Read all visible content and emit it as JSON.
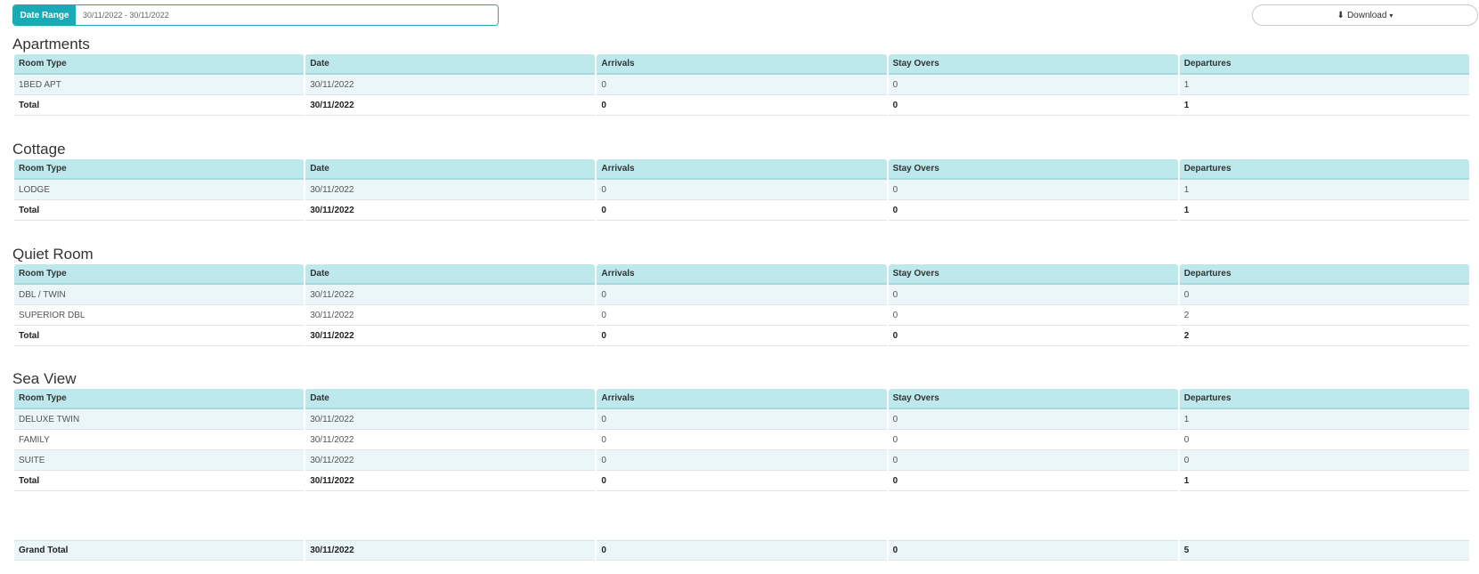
{
  "toolbar": {
    "date_range_label": "Date Range",
    "date_range_value": "30/11/2022 - 30/11/2022",
    "download_label": "Download"
  },
  "columns": [
    "Room Type",
    "Date",
    "Arrivals",
    "Stay Overs",
    "Departures"
  ],
  "sections": [
    {
      "title": "Apartments",
      "rows": [
        [
          "1BED APT",
          "30/11/2022",
          "0",
          "0",
          "1"
        ]
      ],
      "total": [
        "Total",
        "30/11/2022",
        "0",
        "0",
        "1"
      ]
    },
    {
      "title": "Cottage",
      "rows": [
        [
          "LODGE",
          "30/11/2022",
          "0",
          "0",
          "1"
        ]
      ],
      "total": [
        "Total",
        "30/11/2022",
        "0",
        "0",
        "1"
      ]
    },
    {
      "title": "Quiet Room",
      "rows": [
        [
          "DBL / TWIN",
          "30/11/2022",
          "0",
          "0",
          "0"
        ],
        [
          "SUPERIOR DBL",
          "30/11/2022",
          "0",
          "0",
          "2"
        ]
      ],
      "total": [
        "Total",
        "30/11/2022",
        "0",
        "0",
        "2"
      ]
    },
    {
      "title": "Sea View",
      "rows": [
        [
          "DELUXE TWIN",
          "30/11/2022",
          "0",
          "0",
          "1"
        ],
        [
          "FAMILY",
          "30/11/2022",
          "0",
          "0",
          "0"
        ],
        [
          "SUITE",
          "30/11/2022",
          "0",
          "0",
          "0"
        ]
      ],
      "total": [
        "Total",
        "30/11/2022",
        "0",
        "0",
        "1"
      ]
    }
  ],
  "grand_total": [
    "Grand Total",
    "30/11/2022",
    "0",
    "0",
    "5"
  ]
}
